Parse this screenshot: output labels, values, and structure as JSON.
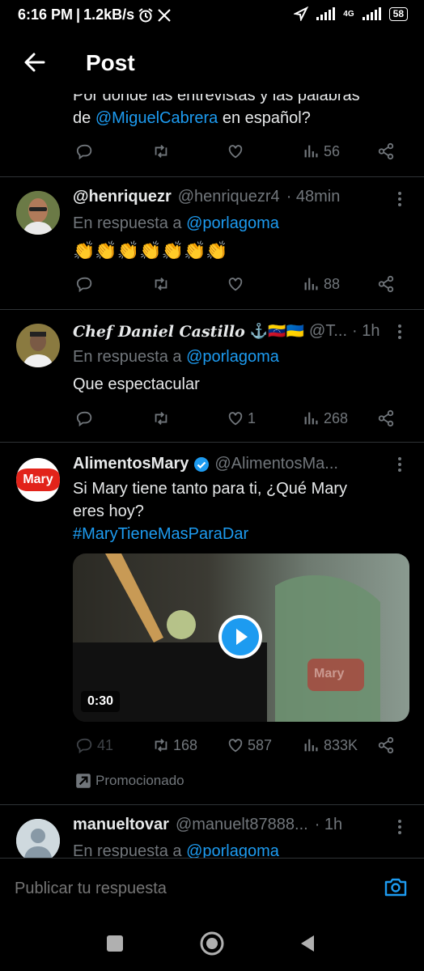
{
  "status_bar": {
    "time": "6:16 PM",
    "speed": "1.2kB/s",
    "network": "4G",
    "battery": "58"
  },
  "header": {
    "title": "Post"
  },
  "top_post": {
    "text_line1": "Por dónde las entrevistas y las palabras",
    "text_line2_prefix": "de ",
    "mention": "@MiguelCabrera",
    "text_line2_suffix": " en español?",
    "views": "56"
  },
  "replies": [
    {
      "name": "@henriquezr",
      "handle": "@henriquezr4",
      "time": "· 48min",
      "reply_prefix": "En respuesta a ",
      "reply_to": "@porlagoma",
      "text": "👏👏👏👏👏👏👏",
      "views": "88"
    },
    {
      "name": "Chef Daniel Castillo",
      "name_emoji": "⚓🇻🇪🇺🇦",
      "handle": "@T...",
      "time": "· 1h",
      "reply_prefix": "En respuesta a ",
      "reply_to": "@porlagoma",
      "text": "Que espectacular",
      "likes": "1",
      "views": "268"
    }
  ],
  "ad": {
    "avatar_text": "Mary",
    "name": "AlimentosMary",
    "handle": "@AlimentosMa...",
    "text_line1": "Si Mary tiene tanto para ti, ¿Qué Mary",
    "text_line2": "eres hoy?",
    "hashtag": "#MaryTieneMasParaDar",
    "video_duration": "0:30",
    "package_label": "Mary",
    "replies": "41",
    "retweets": "168",
    "likes": "587",
    "views": "833K",
    "promoted": "Promocionado"
  },
  "last_reply": {
    "name": "manueltovar",
    "handle": "@manuelt87888...",
    "time": "· 1h",
    "reply_prefix": "En respuesta a ",
    "reply_to": "@porlagoma"
  },
  "reply_bar": {
    "placeholder": "Publicar tu respuesta"
  },
  "colors": {
    "accent": "#1d9bf0",
    "muted": "#71767b",
    "background": "#000000",
    "brand_red": "#e2231a"
  }
}
